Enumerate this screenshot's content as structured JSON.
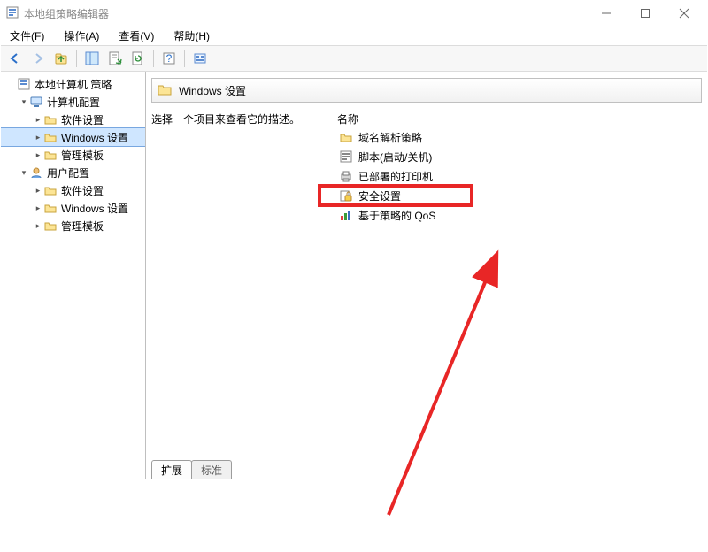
{
  "title": "本地组策略编辑器",
  "menus": {
    "file": "文件(F)",
    "action": "操作(A)",
    "view": "查看(V)",
    "help": "帮助(H)"
  },
  "tree": {
    "root": "本地计算机 策略",
    "comp": "计算机配置",
    "c_soft": "软件设置",
    "c_win": "Windows 设置",
    "c_tmpl": "管理模板",
    "user": "用户配置",
    "u_soft": "软件设置",
    "u_win": "Windows 设置",
    "u_tmpl": "管理模板"
  },
  "header_title": "Windows 设置",
  "desc_prompt": "选择一个项目来查看它的描述。",
  "list_header": "名称",
  "items": {
    "dns": "域名解析策略",
    "scripts": "脚本(启动/关机)",
    "printers": "已部署的打印机",
    "security": "安全设置",
    "qos": "基于策略的 QoS"
  },
  "tabs": {
    "extended": "扩展",
    "standard": "标准"
  }
}
